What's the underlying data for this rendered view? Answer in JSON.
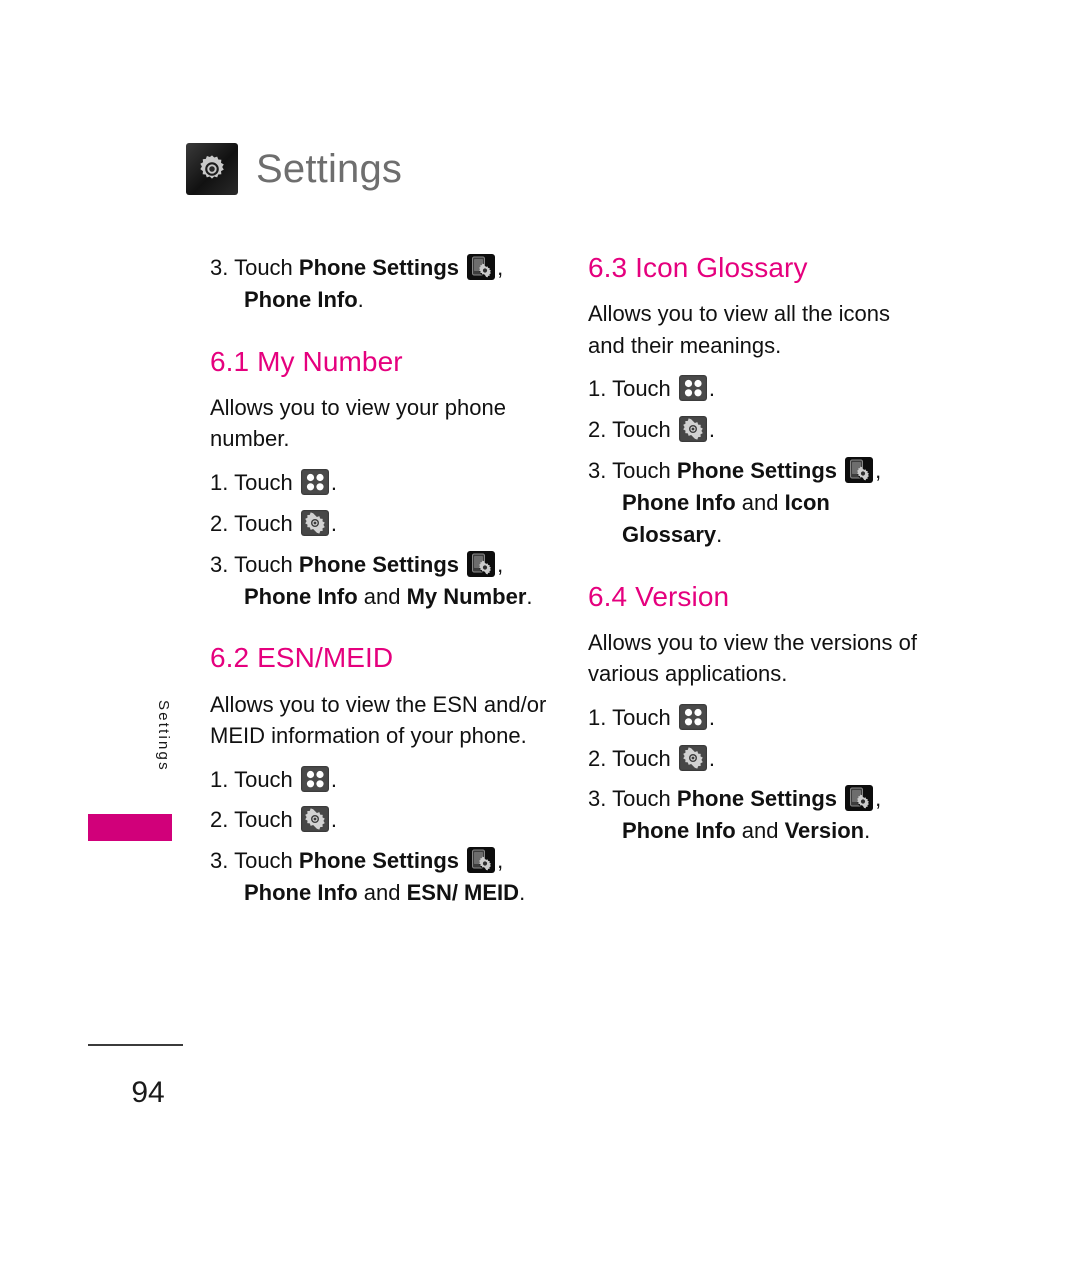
{
  "header": {
    "title": "Settings",
    "icon": "gear-icon"
  },
  "side_tab": {
    "label": "Settings",
    "bar_color": "#d1007a"
  },
  "colors": {
    "heading_magenta": "#e5007e",
    "tab_magenta": "#d1007a",
    "header_title_gray": "#6e6e6e",
    "body_black": "#111111"
  },
  "icons": {
    "grid": "four-dot-grid-icon",
    "gear": "gear-icon",
    "phone_settings": "phone-settings-icon"
  },
  "left_column": {
    "intro_step": {
      "num": "3.",
      "touch": "Touch",
      "bold1": "Phone Settings",
      "comma": ",",
      "line2_bold": "Phone Info",
      "line2_end": "."
    },
    "section_my_number": {
      "heading": "6.1 My Number",
      "body": "Allows you to view your phone number.",
      "steps": [
        {
          "num": "1.",
          "touch": "Touch",
          "tail": "."
        },
        {
          "num": "2.",
          "touch": "Touch",
          "tail": "."
        },
        {
          "num": "3.",
          "touch": "Touch",
          "bold1": "Phone Settings",
          "comma": ",",
          "line2_bold1": "Phone Info",
          "line2_mid": " and ",
          "line2_bold2": "My Number",
          "line2_end": "."
        }
      ]
    },
    "section_esn_meid": {
      "heading": "6.2 ESN/MEID",
      "body": "Allows you to view the ESN and/or MEID information of your phone.",
      "steps": [
        {
          "num": "1.",
          "touch": "Touch",
          "tail": "."
        },
        {
          "num": "2.",
          "touch": "Touch",
          "tail": "."
        },
        {
          "num": "3.",
          "touch": "Touch",
          "bold1": "Phone Settings",
          "comma": ",",
          "line2_bold1": "Phone Info",
          "line2_mid": " and ",
          "line2_bold2": "ESN/ MEID",
          "line2_end": "."
        }
      ]
    }
  },
  "right_column": {
    "section_icon_glossary": {
      "heading": "6.3 Icon Glossary",
      "body": "Allows you to view all the icons and their meanings.",
      "steps": [
        {
          "num": "1.",
          "touch": "Touch",
          "tail": "."
        },
        {
          "num": "2.",
          "touch": "Touch",
          "tail": "."
        },
        {
          "num": "3.",
          "touch": "Touch",
          "bold1": "Phone Settings",
          "comma": ",",
          "line2_bold1": "Phone Info",
          "line2_mid": " and ",
          "line2_bold2": "Icon",
          "line3_bold": "Glossary",
          "line3_end": "."
        }
      ]
    },
    "section_version": {
      "heading": "6.4 Version",
      "body": "Allows you to view the versions of various applications.",
      "steps": [
        {
          "num": "1.",
          "touch": "Touch",
          "tail": "."
        },
        {
          "num": "2.",
          "touch": "Touch",
          "tail": "."
        },
        {
          "num": "3.",
          "touch": "Touch",
          "bold1": "Phone Settings",
          "comma": ",",
          "line2_bold1": "Phone Info",
          "line2_mid": " and ",
          "line2_bold2": "Version",
          "line2_end": "."
        }
      ]
    }
  },
  "footer": {
    "page_number": "94"
  }
}
